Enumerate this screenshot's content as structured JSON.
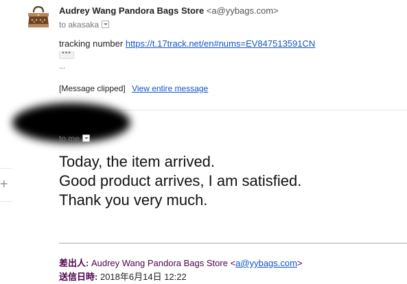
{
  "message1": {
    "sender_name": "Audrey Wang Pandora Bags Store",
    "sender_email": "<a@yybags.com>",
    "to_text": "to akasaka",
    "tracking_label": "tracking number",
    "tracking_link": "https://t.17track.net/en#nums=EV847513591CN",
    "ellipsis_button": "•••",
    "dots": "...",
    "clipped_label": "[Message clipped]",
    "view_entire": "View entire message"
  },
  "message2": {
    "to_text": "to me",
    "body_lines": [
      "Today, the item arrived.",
      "Good product arrives, I am satisfied.",
      "Thank you very much."
    ],
    "forward_from_label": "差出人:",
    "forward_from_name": "Audrey Wang Pandora Bags Store",
    "forward_from_email_open": "<",
    "forward_from_email": "a@yybags.com",
    "forward_from_email_close": ">",
    "forward_date_label": "送信日時:",
    "forward_date": "2018年6月14日 12:22"
  },
  "left_rail": {
    "expand_symbol": "+"
  },
  "icons": [
    "handbag-avatar-icon",
    "dropdown-arrow-icon",
    "expand-plus-icon"
  ]
}
